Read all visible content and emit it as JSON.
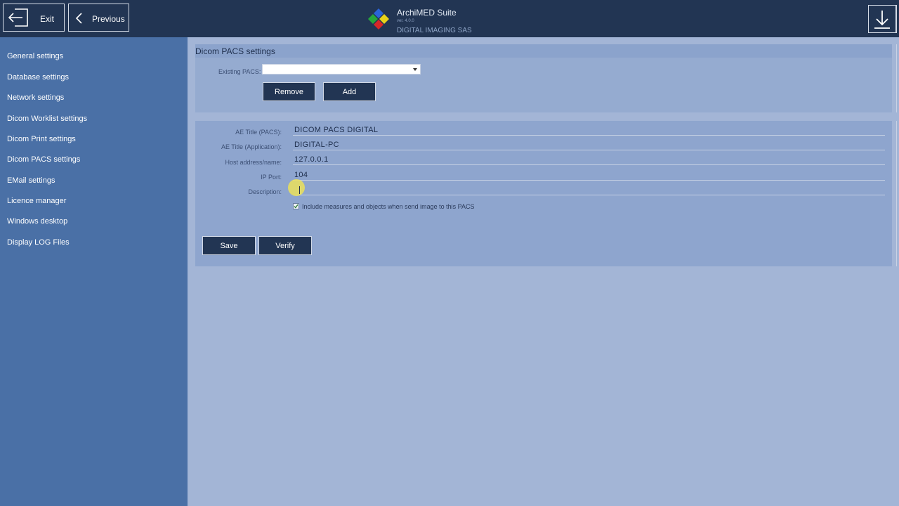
{
  "topbar": {
    "exit_label": "Exit",
    "previous_label": "Previous",
    "app_name": "ArchiMED Suite",
    "version": "ver. 4.0.0",
    "company": "DIGITAL IMAGING SAS"
  },
  "sidebar": {
    "items": [
      {
        "label": "General settings"
      },
      {
        "label": "Database settings"
      },
      {
        "label": "Network settings"
      },
      {
        "label": "Dicom Worklist settings"
      },
      {
        "label": "Dicom Print settings"
      },
      {
        "label": "Dicom PACS settings"
      },
      {
        "label": "EMail settings"
      },
      {
        "label": "Licence manager"
      },
      {
        "label": "Windows desktop"
      },
      {
        "label": "Display LOG Files"
      }
    ]
  },
  "pacs": {
    "title": "Dicom PACS settings",
    "existing_label": "Existing PACS:",
    "existing_value": "",
    "remove_label": "Remove",
    "add_label": "Add"
  },
  "form": {
    "fields": [
      {
        "label": "AE Title (PACS):",
        "value": "DICOM PACS DIGITAL"
      },
      {
        "label": "AE Title (Application):",
        "value": "DIGITAL-PC"
      },
      {
        "label": "Host address/name:",
        "value": "127.0.0.1"
      },
      {
        "label": "IP Port:",
        "value": "104"
      },
      {
        "label": "Description:",
        "value": ""
      }
    ],
    "include_label": "Include measures and objects when send image to this PACS",
    "include_checked": true,
    "save_label": "Save",
    "verify_label": "Verify"
  },
  "colors": {
    "topbar": "#223553",
    "sidebar": "#4a70a6",
    "main": "#a3b5d6",
    "button": "#223553"
  }
}
